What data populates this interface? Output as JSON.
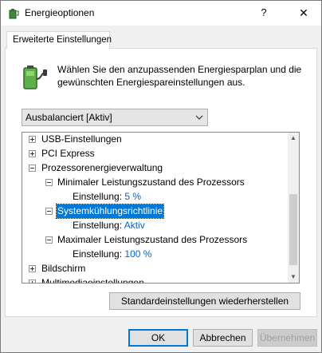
{
  "window": {
    "title": "Energieoptionen",
    "help_label": "?",
    "close_label": "✕"
  },
  "tab": {
    "label": "Erweiterte Einstellungen"
  },
  "description": "Wählen Sie den anzupassenden Energiesparplan und die gewünschten Energiespareinstellungen aus.",
  "plan_select": {
    "value": "Ausbalanciert [Aktiv]"
  },
  "tree": {
    "usb": "USB-Einstellungen",
    "pci": "PCI Express",
    "cpu": "Prozessorenergieverwaltung",
    "min_state": "Minimaler Leistungszustand des Prozessors",
    "min_setting_label": "Einstellung:",
    "min_setting_value": "5 %",
    "cooling": "Systemkühlungsrichtlinie",
    "cooling_setting_label": "Einstellung:",
    "cooling_setting_value": "Aktiv",
    "max_state": "Maximaler Leistungszustand des Prozessors",
    "max_setting_label": "Einstellung:",
    "max_setting_value": "100 %",
    "display": "Bildschirm",
    "multimedia": "Multimediaeinstellungen"
  },
  "buttons": {
    "restore": "Standardeinstellungen wiederherstellen",
    "ok": "OK",
    "cancel": "Abbrechen",
    "apply": "Übernehmen"
  },
  "icons": {
    "window": "power-options-icon",
    "battery": "battery-plug-icon",
    "dropdown": "chevron-down-icon"
  },
  "colors": {
    "selection": "#0078d7",
    "value_text": "#0066cc"
  }
}
